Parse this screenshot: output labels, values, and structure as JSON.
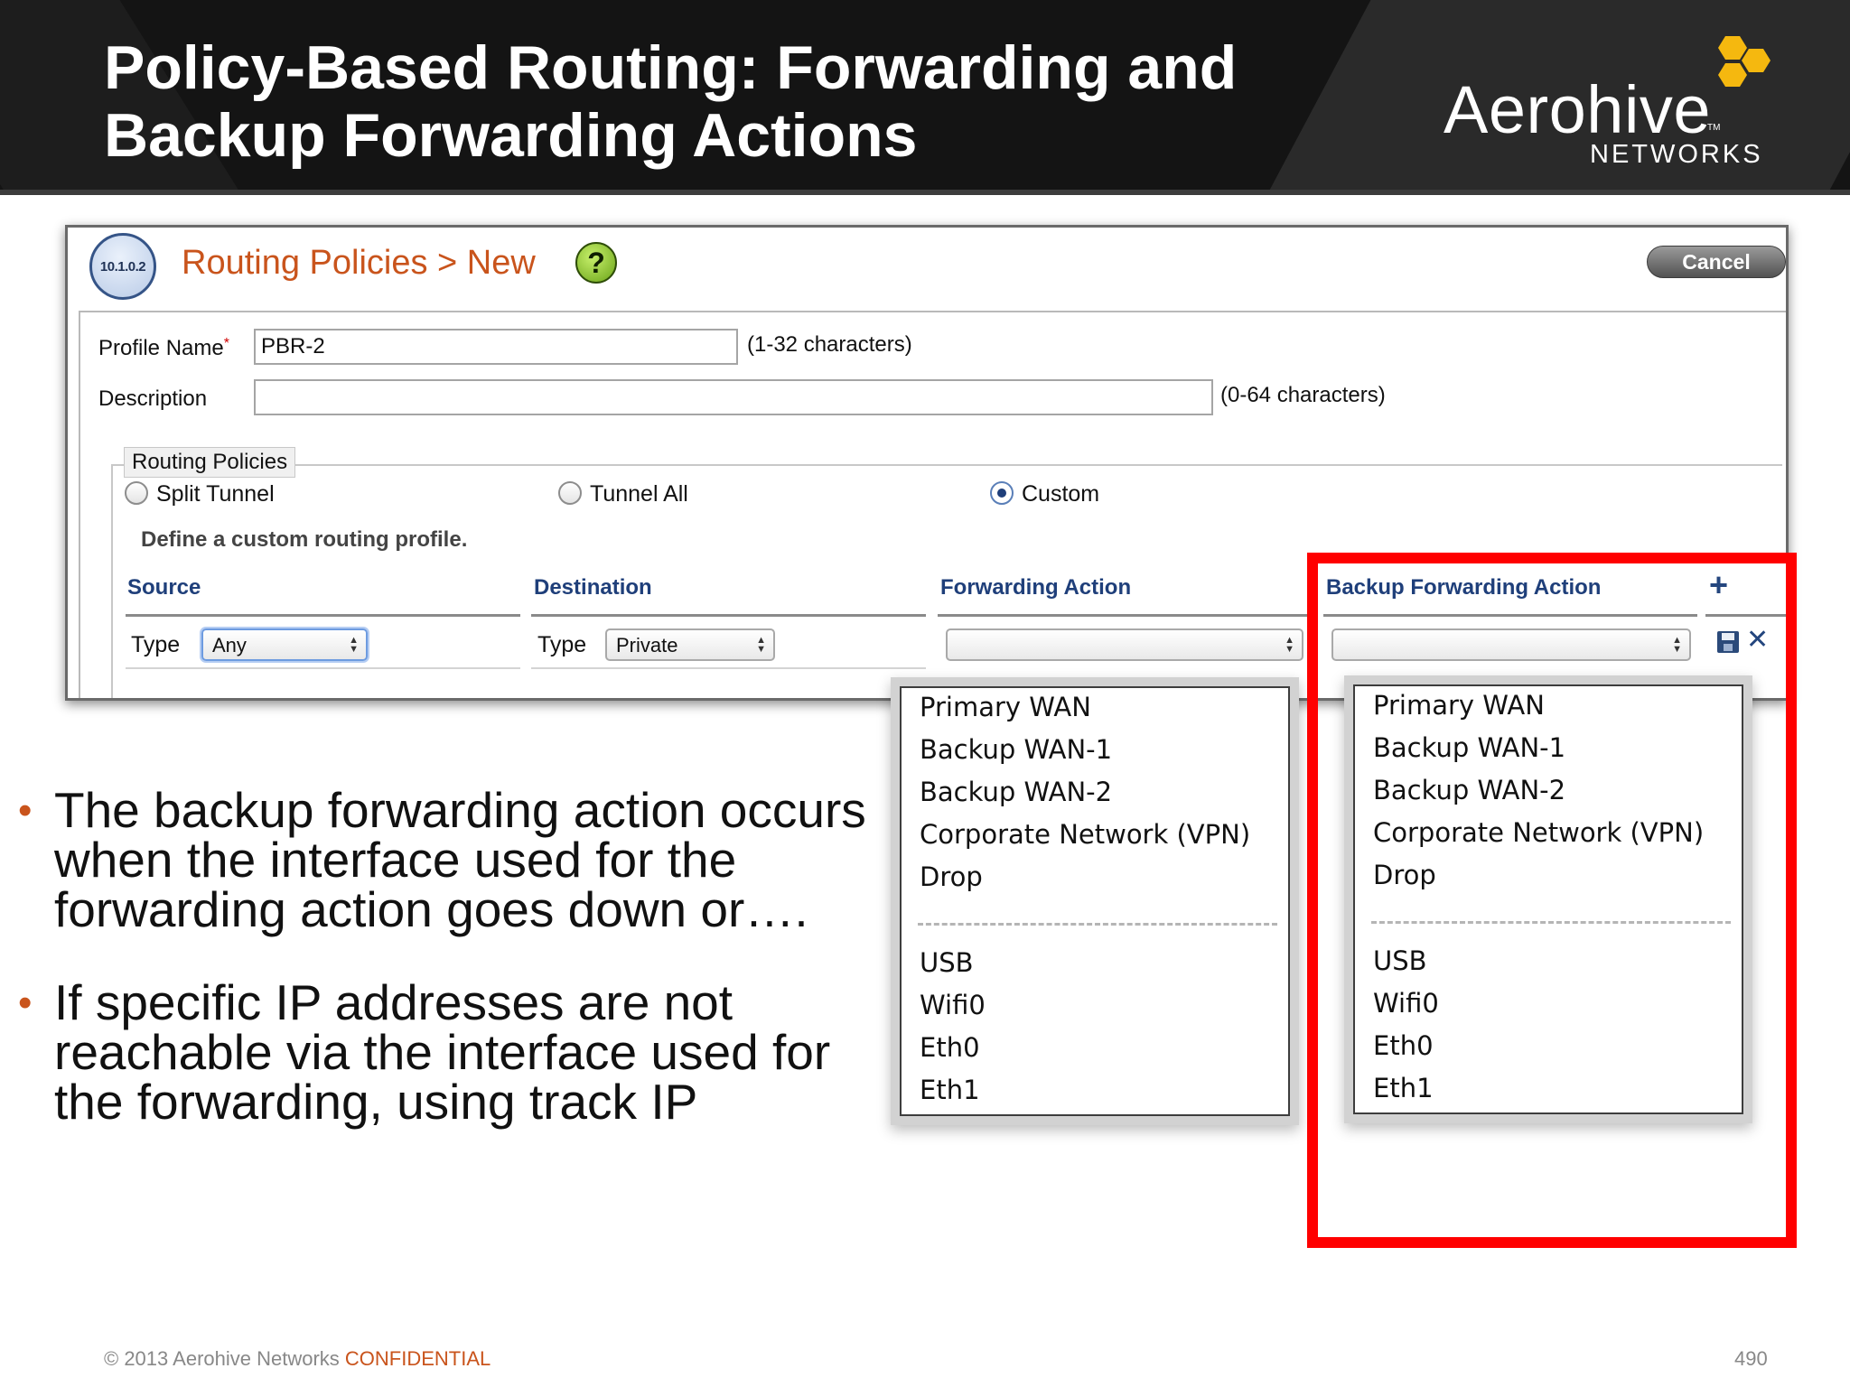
{
  "slide": {
    "title_line1": "Policy-Based Routing: Forwarding and",
    "title_line2": "Backup Forwarding Actions",
    "logo_word": "Aerohive",
    "logo_tm": "TM",
    "logo_sub": "NETWORKS"
  },
  "dialog": {
    "ip_badge": "10.1.0.2",
    "title": "Routing Policies > New",
    "help_glyph": "?",
    "cancel_label": "Cancel",
    "profile_name_label": "Profile Name",
    "required_mark": "*",
    "profile_name_value": "PBR-2",
    "profile_name_hint": "(1-32 characters)",
    "description_label": "Description",
    "description_value": "",
    "description_hint": "(0-64 characters)",
    "routing_policies_legend": "Routing Policies",
    "radio_options": [
      {
        "label": "Split Tunnel",
        "checked": false
      },
      {
        "label": "Tunnel All",
        "checked": false
      },
      {
        "label": "Custom",
        "checked": true
      }
    ],
    "custom_hint": "Define a custom routing profile.",
    "columns": {
      "source": "Source",
      "destination": "Destination",
      "forwarding_action": "Forwarding Action",
      "backup_forwarding_action": "Backup Forwarding Action"
    },
    "row": {
      "source_type_label": "Type",
      "source_type_value": "Any",
      "destination_type_label": "Type",
      "destination_type_value": "Private",
      "forwarding_action_value": "",
      "backup_forwarding_action_value": ""
    }
  },
  "dropdown_options": {
    "group1": [
      "Primary WAN",
      "Backup WAN-1",
      "Backup WAN-2",
      "Corporate Network (VPN)",
      "Drop"
    ],
    "group2": [
      "USB",
      "Wifi0",
      "Eth0",
      "Eth1"
    ]
  },
  "bullets": [
    "The backup forwarding action occurs when the interface used for the forwarding action goes down or….",
    "If specific IP addresses are not reachable via the interface used for the forwarding, using track IP"
  ],
  "footer": {
    "copyright": "© 2013 Aerohive Networks ",
    "confidential": "CONFIDENTIAL",
    "page_number": "490"
  },
  "colors": {
    "accent_orange": "#c9541c",
    "highlight_red": "#ff0000",
    "link_blue": "#1f3f7a"
  }
}
